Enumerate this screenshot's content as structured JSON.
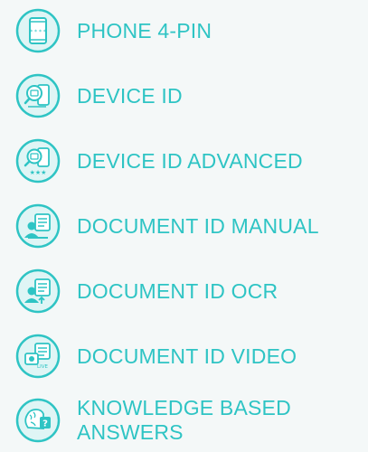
{
  "accent_color": "#2ec4c4",
  "background_color": "#f4f8f8",
  "items": [
    {
      "label": "PHONE 4-PIN",
      "icon": "phone-pin-icon"
    },
    {
      "label": "DEVICE ID",
      "icon": "device-id-icon"
    },
    {
      "label": "DEVICE ID ADVANCED",
      "icon": "device-id-advanced-icon"
    },
    {
      "label": "DOCUMENT ID MANUAL",
      "icon": "document-id-manual-icon"
    },
    {
      "label": "DOCUMENT ID OCR",
      "icon": "document-id-ocr-icon"
    },
    {
      "label": "DOCUMENT ID VIDEO",
      "icon": "document-id-video-icon"
    },
    {
      "label": "KNOWLEDGE BASED ANSWERS",
      "icon": "knowledge-based-answers-icon"
    }
  ]
}
